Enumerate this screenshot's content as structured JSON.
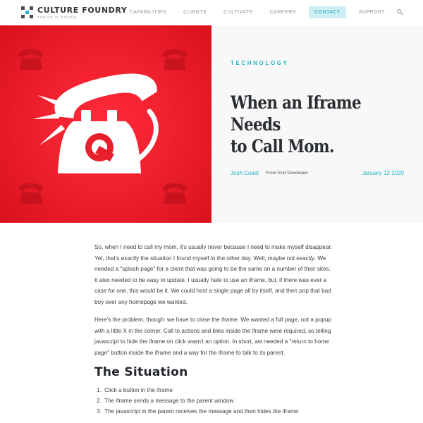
{
  "header": {
    "logo_name": "CULTURE FOUNDRY",
    "logo_tagline": "THRIVE IN DIGITAL",
    "nav": [
      "CAPABILITIES",
      "CLIENTS",
      "CULTIVATE",
      "CAREERS",
      "CONTACT",
      "SUPPORT"
    ],
    "active_nav": "CONTACT"
  },
  "hero": {
    "category": "TECHNOLOGY",
    "title_line1": "When an Iframe Needs",
    "title_line2": "to Call Mom.",
    "author": "Josh Coast",
    "author_role": "Front End Developer",
    "date": "January 12 2020"
  },
  "article": {
    "p1_a": "So, when I need to call my mom, it's usually never because I need to make myself disappear. Yet, that's exactly the situation I found myself in the other day. Well, maybe not ",
    "p1_em": "exactly",
    "p1_b": ". We needed a \"splash page\" for a client that was going to be the same on a number of their sites. It also needed to be easy to update. I usually hate to use an iframe, but, if there was ever a case for one, this would be it. We could host a single page all by itself, and then pop that bad boy over any homepage we wanted.",
    "p2": "Here's the problem, though: we have to close the iframe. We wanted a full page, not a popup with a little X in the corner. Call to actions and links inside the iframe were required, so telling javascript to hide the iframe on click wasn't an option. In short, we needed a \"return to home page\" button inside the iframe and a way for the iframe to talk to its parent.",
    "heading": "The Situation",
    "steps": [
      {
        "num": "1.",
        "text": "Click a button in the iframe"
      },
      {
        "num": "2.",
        "text": "The iframe sends a message to the parent window"
      },
      {
        "num": "3.",
        "text": "The javascript in the parent receives the message and then hides the iframe"
      }
    ]
  },
  "colors": {
    "accent": "#23b3c6",
    "hero_red": "#f0202e",
    "contact_bg": "#cdeff3"
  },
  "icons": [
    "logo-grid-icon",
    "search-icon",
    "telephone-icon"
  ]
}
